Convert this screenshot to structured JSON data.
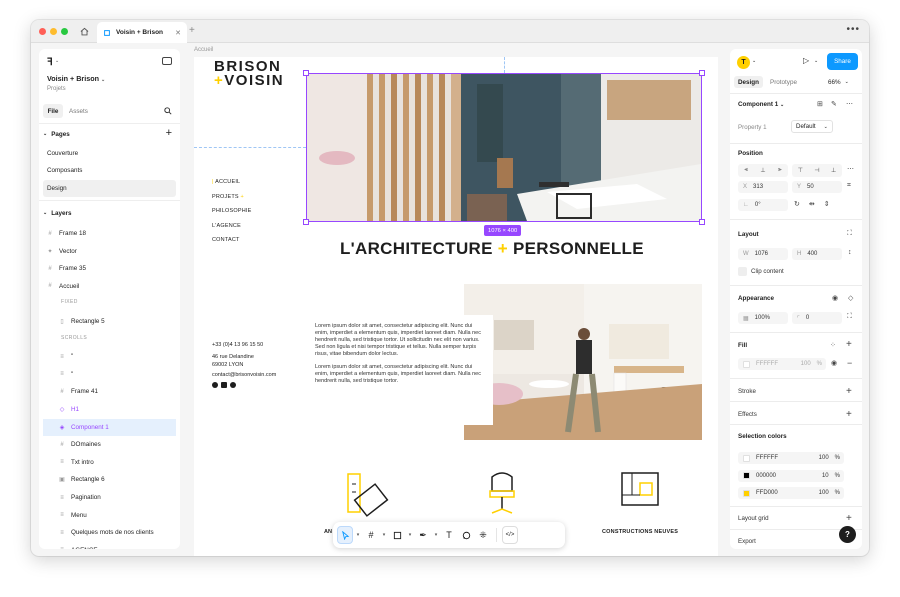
{
  "tabs": {
    "home_icon": "home-icon",
    "active_title": "Voisin + Brison"
  },
  "left": {
    "project_name": "Voisin + Brison",
    "project_sub": "Projets",
    "file_tab": "File",
    "assets_tab": "Assets",
    "pages_title": "Pages",
    "pages": [
      "Couverture",
      "Composants",
      "Design"
    ],
    "layers_title": "Layers",
    "layers": [
      {
        "label": "Frame 18",
        "icon": "frame-icon",
        "indent": 0
      },
      {
        "label": "Vector",
        "icon": "vector-icon",
        "indent": 0
      },
      {
        "label": "Frame 35",
        "icon": "frame-icon",
        "indent": 0
      },
      {
        "label": "Accueil",
        "icon": "frame-icon",
        "indent": 0
      },
      {
        "label": "FIXED",
        "icon": "",
        "indent": 1,
        "caption": true
      },
      {
        "label": "Rectangle 5",
        "icon": "rect-icon",
        "indent": 1
      },
      {
        "label": "SCROLLS",
        "icon": "",
        "indent": 1,
        "caption": true
      },
      {
        "label": "\"",
        "icon": "text-icon",
        "indent": 1
      },
      {
        "label": "\"",
        "icon": "text-icon",
        "indent": 1
      },
      {
        "label": "Frame 41",
        "icon": "frame-icon",
        "indent": 1
      },
      {
        "label": "H1",
        "icon": "instance-icon",
        "indent": 1,
        "purple": true
      },
      {
        "label": "Component 1",
        "icon": "component-icon",
        "indent": 1,
        "purple": true,
        "selected": true
      },
      {
        "label": "DOmaines",
        "icon": "frame-icon",
        "indent": 1
      },
      {
        "label": "Txt intro",
        "icon": "text-icon",
        "indent": 1
      },
      {
        "label": "Rectangle 6",
        "icon": "image-icon",
        "indent": 1
      },
      {
        "label": "Pagination",
        "icon": "text-icon",
        "indent": 1
      },
      {
        "label": "Menu",
        "icon": "text-icon",
        "indent": 1
      },
      {
        "label": "Quelques mots de nos clients",
        "icon": "text-icon",
        "indent": 1
      },
      {
        "label": "AGENCE",
        "icon": "text-icon",
        "indent": 1
      }
    ]
  },
  "canvas": {
    "breadcrumb": "Accueil",
    "logo_line1": "BRISON",
    "logo_line2": "VOISIN",
    "nav": [
      "ACCUEIL",
      "PROJETS",
      "PHILOSOPHIE",
      "L'AGENCE",
      "CONTACT"
    ],
    "size_badge": "1076 × 400",
    "headline_left": "L'ARCHITECTURE",
    "headline_right": "PERSONNELLE",
    "phone": "+33 (0)4 13 96 15 50",
    "address1": "46 rue Delandine",
    "address2": "69002 LYON",
    "email": "contact@brisonvoisin.com",
    "lorem1": "Lorem ipsum dolor sit amet, consectetur adipiscing elit. Nunc dui enim, imperdiet a elementum quis, imperdiet laoreet diam. Nulla nec hendrerit nulla, sed tristique tortor. Ut sollicitudin nec elit non varius. Sed non ligula et nisi tempor tristique et tellus. Nulla semper turpis risus, vitae bibendum dolor lectus.",
    "lorem2": "Lorem ipsum dolor sit amet, consectetur adipiscing elit. Nunc dui enim, imperdiet a elementum quis, imperdiet laoreet diam. Nulla nec hendrerit nulla, sed tristique tortor.",
    "domain_left": "AN",
    "domain_right": "CONSTRUCTIONS NEUVES"
  },
  "right": {
    "avatar": "T",
    "share": "Share",
    "design_tab": "Design",
    "prototype_tab": "Prototype",
    "zoom": "66%",
    "component_name": "Component 1",
    "property_label": "Property 1",
    "property_value": "Default",
    "position_title": "Position",
    "x_label": "X",
    "x_value": "313",
    "y_label": "Y",
    "y_value": "50",
    "rotation_value": "0°",
    "layout_title": "Layout",
    "w_label": "W",
    "w_value": "1076",
    "h_label": "H",
    "h_value": "400",
    "clip_content": "Clip content",
    "appearance_title": "Appearance",
    "opacity": "100%",
    "radius": "0",
    "fill_title": "Fill",
    "fill_hex": "FFFFFF",
    "fill_opacity": "100",
    "fill_pct": "%",
    "stroke_title": "Stroke",
    "effects_title": "Effects",
    "selection_colors_title": "Selection colors",
    "selection_colors": [
      {
        "hex": "FFFFFF",
        "opacity": "100",
        "pct": "%",
        "swatch": "#ffffff"
      },
      {
        "hex": "000000",
        "opacity": "10",
        "pct": "%",
        "swatch": "#000000"
      },
      {
        "hex": "FFD000",
        "opacity": "100",
        "pct": "%",
        "swatch": "#ffd000"
      }
    ],
    "layout_grid_title": "Layout grid",
    "export_title": "Export"
  },
  "toolbar": {
    "tools": [
      "move-tool-icon",
      "frame-tool-icon",
      "rectangle-tool-icon",
      "pen-tool-icon",
      "text-tool-icon",
      "comment-tool-icon",
      "components-tool-icon",
      "dev-mode-icon"
    ]
  },
  "help": "?",
  "colors": {
    "accent_yellow": "#ffd000",
    "selection_purple": "#9747ff",
    "share_blue": "#0d99ff"
  }
}
